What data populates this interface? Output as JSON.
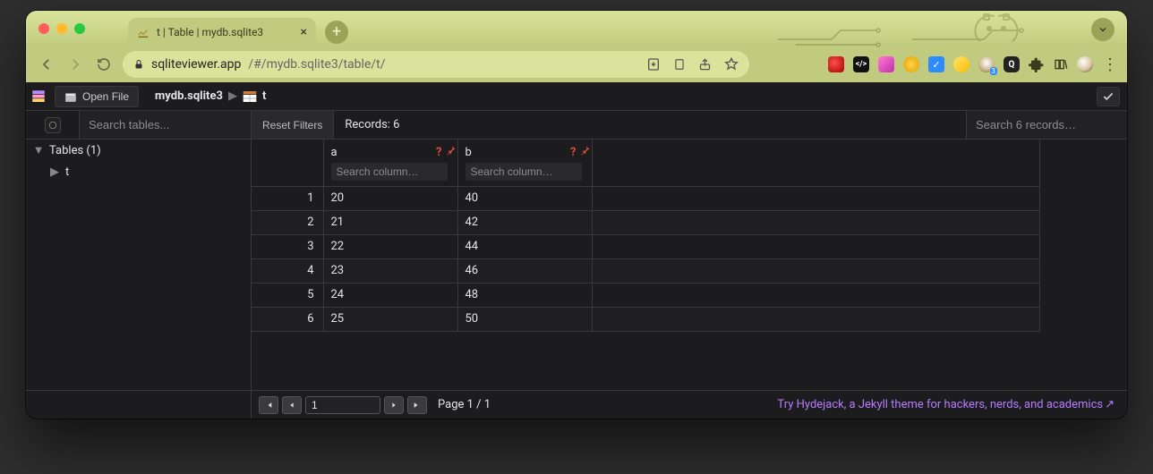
{
  "browser": {
    "tab_title": "t | Table | mydb.sqlite3",
    "url_host": "sqliteviewer.app",
    "url_path": "/#/mydb.sqlite3/table/t/"
  },
  "topbar": {
    "open_file_label": "Open File",
    "db_name": "mydb.sqlite3",
    "table_name": "t"
  },
  "subbar": {
    "search_tables_placeholder": "Search tables...",
    "reset_label": "Reset Filters",
    "records_label": "Records: 6",
    "search_records_placeholder": "Search 6 records…"
  },
  "sidebar": {
    "group_label": "Tables (1)",
    "items": [
      "t"
    ]
  },
  "columns": [
    {
      "name": "a",
      "search_placeholder": "Search column…"
    },
    {
      "name": "b",
      "search_placeholder": "Search column…"
    }
  ],
  "rows": [
    {
      "n": "1",
      "a": "20",
      "b": "40"
    },
    {
      "n": "2",
      "a": "21",
      "b": "42"
    },
    {
      "n": "3",
      "a": "22",
      "b": "44"
    },
    {
      "n": "4",
      "a": "23",
      "b": "46"
    },
    {
      "n": "5",
      "a": "24",
      "b": "48"
    },
    {
      "n": "6",
      "a": "25",
      "b": "50"
    }
  ],
  "footer": {
    "page_input": "1",
    "page_label": "Page 1 / 1",
    "promo": "Try Hydejack, a Jekyll theme for hackers, nerds, and academics"
  }
}
